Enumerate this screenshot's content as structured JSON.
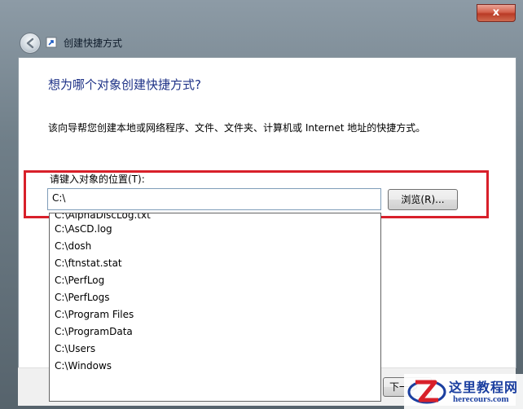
{
  "window": {
    "title": "创建快捷方式",
    "close_label": "x"
  },
  "wizard": {
    "heading": "想为哪个对象创建快捷方式?",
    "description": "该向导帮您创建本地或网络程序、文件、文件夹、计算机或 Internet 地址的快捷方式。",
    "location_label": "请键入对象的位置(T):",
    "location_value": "C:\\",
    "browse_label": "浏览(R)...",
    "next_label": "下一步(N)"
  },
  "autocomplete": {
    "items": [
      "C:\\AlphaDiscLog.txt",
      "C:\\AsCD.log",
      "C:\\dosh",
      "C:\\ftnstat.stat",
      "C:\\PerfLog",
      "C:\\PerfLogs",
      "C:\\Program Files",
      "C:\\ProgramData",
      "C:\\Users",
      "C:\\Windows"
    ]
  },
  "watermark": {
    "title": "这里教程网",
    "url": "herecours.com"
  },
  "colors": {
    "heading": "#1e3287",
    "highlight_box": "#d8202a",
    "close_button": "#c94b34"
  }
}
